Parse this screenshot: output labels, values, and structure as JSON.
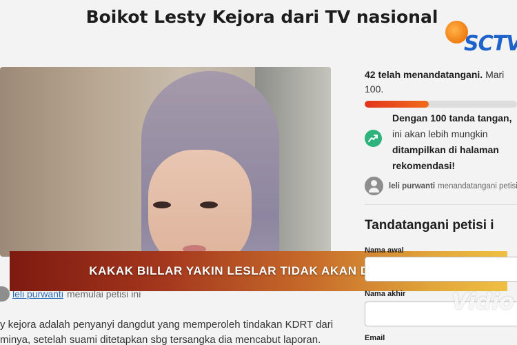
{
  "page": {
    "title": "Boikot Lesty Kejora dari TV nasional"
  },
  "channel": {
    "logo_text": "SCTV"
  },
  "news": {
    "headline": "KAKAK BILLAR YAKIN LESLAR TIDAK AKAN DIBOIKOT"
  },
  "petition": {
    "starter_name": "leli purwanti",
    "starter_action": "memulai petisi ini",
    "description_line1": "y kejora adalah penyanyi dangdut yang memperoleh tindakan KDRT dari",
    "description_line2": "minya, setelah suami ditetapkan sbg tersangka dia mencabut laporan."
  },
  "signatures": {
    "count_text": "42 telah menandatangani.",
    "goal_text": "Mari",
    "goal_text_2": "100.",
    "progress_fraction": 0.42,
    "milestone_line1": "Dengan 100 tanda tangan,",
    "milestone_line2": "ini akan lebih mungkin",
    "milestone_line3": "ditampilkan di halaman",
    "milestone_line4": "rekomendasi!",
    "recent_signer_name": "leli purwanti",
    "recent_signer_action": "menandatangani petisi"
  },
  "sign_form": {
    "title": "Tandatangani petisi i",
    "first_name_label": "Nama awal",
    "last_name_label": "Nama akhir",
    "email_label": "Email"
  },
  "watermark": {
    "text": "Vidio"
  },
  "colors": {
    "progress": "#e2341c",
    "trend_icon": "#2db37b",
    "link": "#2a6bb8",
    "logo_blue": "#1e63c9",
    "logo_orange": "#f07b12"
  }
}
